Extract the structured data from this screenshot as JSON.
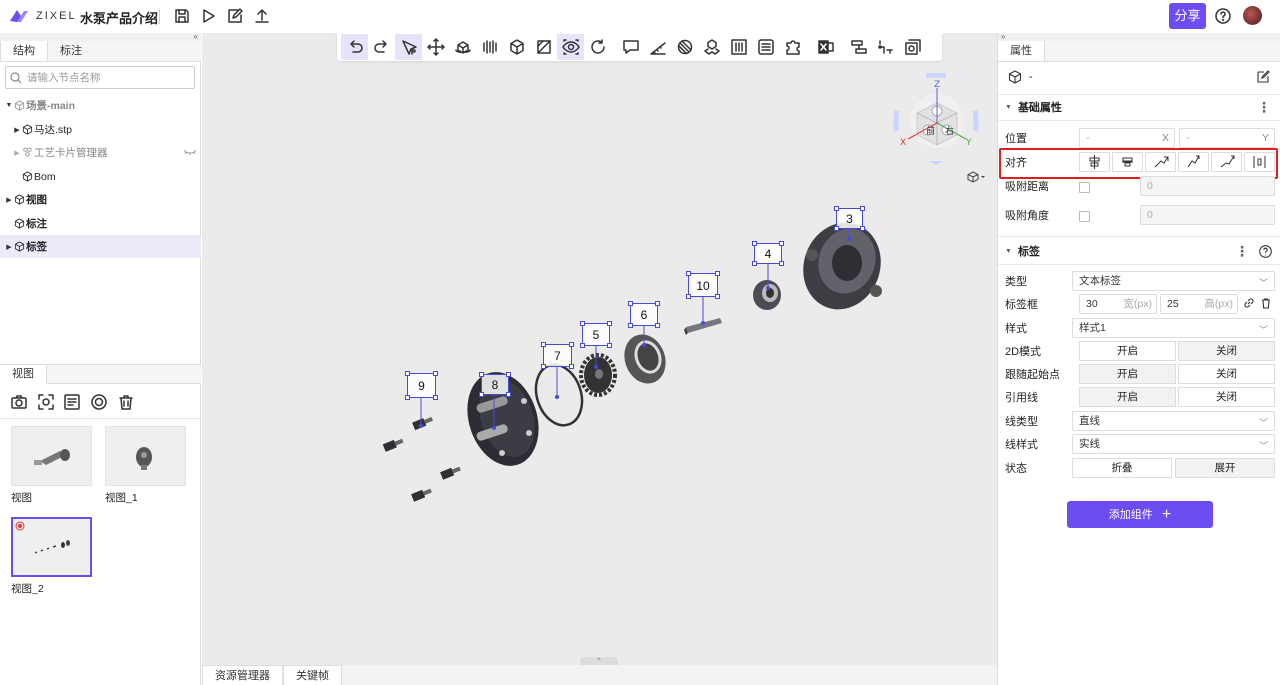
{
  "app": {
    "brand": "ZIXEL",
    "doc_title": "水泵产品介绍",
    "share_label": "分享",
    "brand_color": "#6d4df2"
  },
  "topbar": {
    "icons": [
      "save-icon",
      "play-icon",
      "edit-export-icon",
      "upload-icon"
    ],
    "help_icon": "help-icon"
  },
  "left_panel": {
    "tabs": [
      "结构",
      "标注"
    ],
    "search_placeholder": "请输入节点名称",
    "tree": [
      {
        "label": "场景-main",
        "bold": true,
        "muted": true
      },
      {
        "label": "马达.stp"
      },
      {
        "label": "工艺卡片管理器",
        "muted": true
      },
      {
        "label": "Bom"
      },
      {
        "label": "视图",
        "bold": true
      },
      {
        "label": "标注",
        "bold": true
      },
      {
        "label": "标签",
        "bold": true,
        "selected": true
      }
    ],
    "views_tab": "视图",
    "view_actions": [
      "camera-icon",
      "focus-capture-icon",
      "view-list-icon",
      "target-icon",
      "trash-icon"
    ],
    "views": [
      {
        "label": "视图"
      },
      {
        "label": "视图_1"
      },
      {
        "label": "视图_2",
        "selected": true
      }
    ]
  },
  "viewport": {
    "toolbar": [
      "undo-icon",
      "redo-icon",
      "select-pointer-icon",
      "move-icon",
      "rotate-part-icon",
      "explode-icon",
      "box-view-icon",
      "section-icon",
      "visibility-icon",
      "reset-rotate-icon",
      "comment-icon",
      "measure-icon",
      "material-icon",
      "assembly-icon",
      "dimension-icon",
      "list-icon",
      "component-icon",
      "excel-icon",
      "layout-icon",
      "path-icon",
      "gallery-icon"
    ],
    "part_labels": [
      "3",
      "4",
      "10",
      "6",
      "5",
      "7",
      "8",
      "9"
    ],
    "gizmo_faces": [
      "前",
      "右",
      "Z",
      "Y",
      "X"
    ],
    "bottom_tabs": [
      "资源管理器",
      "关键帧"
    ]
  },
  "right_panel": {
    "tab": "属性",
    "object_name": "-",
    "basic_section": "基础属性",
    "position_label": "位置",
    "position_x_placeholder": "-",
    "position_x_axis": "X",
    "position_y_placeholder": "-",
    "position_y_axis": "Y",
    "align_label": "对齐",
    "snap_distance_label": "吸附距离",
    "snap_distance_value": "0",
    "snap_angle_label": "吸附角度",
    "snap_angle_value": "0",
    "label_section": "标签",
    "type_label": "类型",
    "type_value": "文本标签",
    "label_box_label": "标签框",
    "width_value": "30",
    "width_unit": "宽(px)",
    "height_value": "25",
    "height_unit": "高(px)",
    "style_label": "样式",
    "style_value": "样式1",
    "mode2d_label": "2D模式",
    "follow_label": "跟随起始点",
    "leader_label": "引用线",
    "on_label": "开启",
    "off_label": "关闭",
    "line_type_label": "线类型",
    "line_type_value": "直线",
    "line_style_label": "线样式",
    "line_style_value": "实线",
    "state_label": "状态",
    "collapse_label": "折叠",
    "expand_label": "展开",
    "add_component_label": "添加组件",
    "highlight_color": "#e11d1d"
  }
}
